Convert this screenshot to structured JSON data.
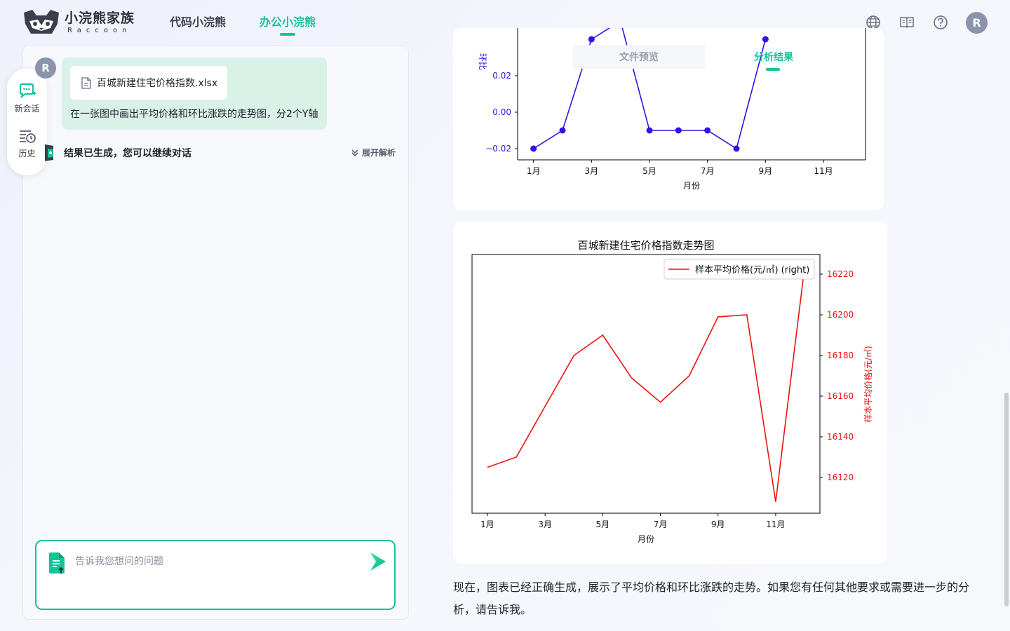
{
  "brand": {
    "name_cn": "小浣熊家族",
    "name_en": "Raccoon"
  },
  "nav": {
    "tabs": [
      {
        "label": "代码小浣熊",
        "active": false
      },
      {
        "label": "办公小浣熊",
        "active": true
      }
    ],
    "accent": "#14c396"
  },
  "header_icons": [
    "globe-icon",
    "book-icon",
    "help-icon"
  ],
  "user": {
    "initial": "R"
  },
  "side_tools": {
    "new_chat": "新会话",
    "history": "历史"
  },
  "conversation": {
    "file_name": "百城新建住宅价格指数.xlsx",
    "user_message": "在一张图中画出平均价格和环比涨跌的走势图，分2个Y轴",
    "bot_status": "结果已生成，您可以继续对话",
    "expand_label": "展开解析"
  },
  "input": {
    "placeholder": "告诉我您想问的问题",
    "value": ""
  },
  "result_tabs": {
    "preview": "文件预览",
    "result": "分析结果",
    "active": "result"
  },
  "chart_data": [
    {
      "type": "line",
      "title": "",
      "xlabel": "月份",
      "ylabel": "环比",
      "ylabel_visible": "环比",
      "x": [
        1,
        2,
        3,
        4,
        5,
        6,
        7,
        8,
        9,
        10,
        11,
        12
      ],
      "x_tick_labels": [
        "1月",
        "3月",
        "5月",
        "7月",
        "9月",
        "11月"
      ],
      "y_tick_labels": [
        "0.02",
        "0.00",
        "−0.02"
      ],
      "series": [
        {
          "name": "",
          "values": [
            -0.02,
            -0.01,
            0.04,
            0.05,
            -0.01,
            -0.01,
            -0.01,
            -0.02,
            0.04
          ],
          "color": "#3212e8",
          "markers": true
        }
      ],
      "note_visible": "chart cropped at top; only lower part visible"
    },
    {
      "type": "line",
      "title": "百城新建住宅价格指数走势图",
      "xlabel": "月份",
      "ylabel": "样本平均价格(元/㎡)",
      "legend": "样本平均价格(元/㎡) (right)",
      "legend_position": "top-right",
      "x_tick_labels": [
        "1月",
        "3月",
        "5月",
        "7月",
        "9月",
        "11月"
      ],
      "y_tick_labels": [
        "16220",
        "16200",
        "16180",
        "16160",
        "16140",
        "16120"
      ],
      "ylim": [
        16105,
        16230
      ],
      "series": [
        {
          "name": "样本平均价格(元/㎡) (right)",
          "color": "#ee1111",
          "values": [
            16125,
            16130,
            16155,
            16180,
            16190,
            16169,
            16157,
            16170,
            16199,
            16200,
            16108,
            16223
          ]
        }
      ]
    }
  ],
  "summary_text": "现在，图表已经正确生成，展示了平均价格和环比涨跌的走势。如果您有任何其他要求或需要进一步的分析，请告诉我。"
}
